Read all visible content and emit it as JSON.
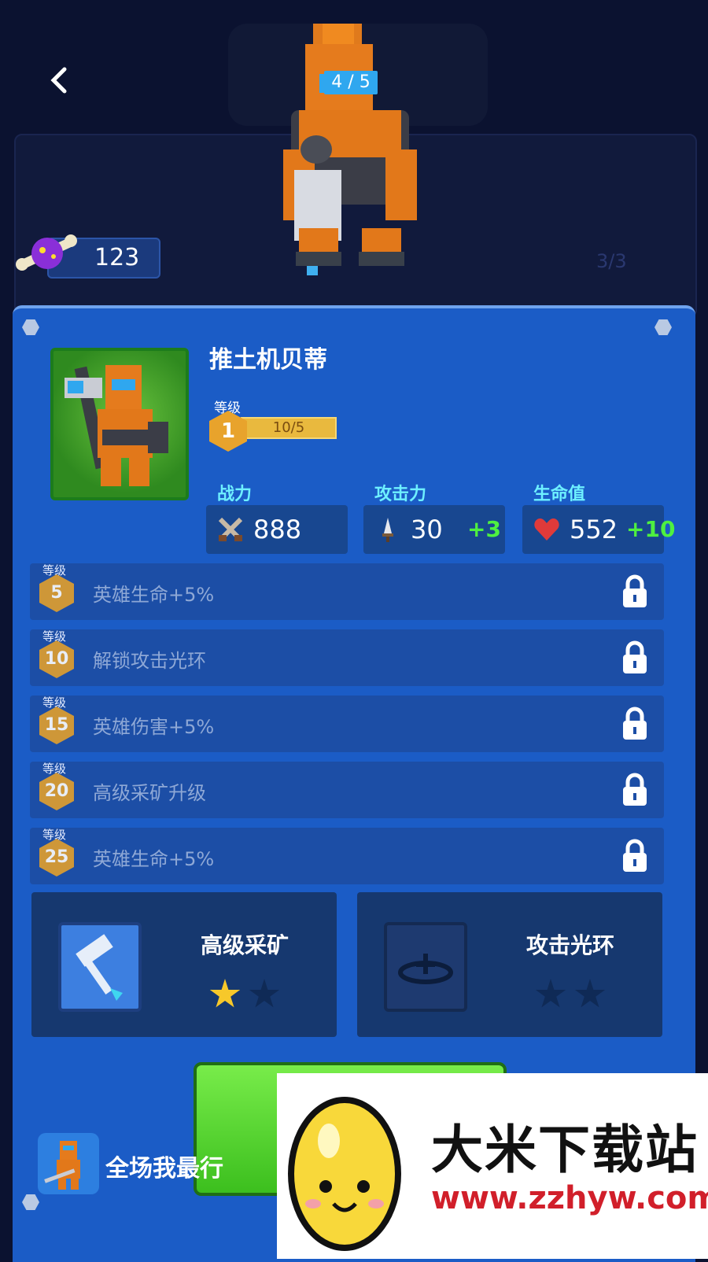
{
  "header": {
    "back_icon": "chevron-left-icon",
    "hero_index": "4 / 5",
    "faded_count": "3/3"
  },
  "currency": {
    "icon": "candy-icon",
    "amount": "123"
  },
  "hero": {
    "name": "推土机贝蒂",
    "level_label": "等级",
    "level": "1",
    "xp": "10/5"
  },
  "stats": [
    {
      "label": "战力",
      "icon": "swords-icon",
      "value": "888",
      "bonus": ""
    },
    {
      "label": "攻击力",
      "icon": "dagger-icon",
      "value": "30",
      "bonus": "+3"
    },
    {
      "label": "生命值",
      "icon": "heart-icon",
      "value": "552",
      "bonus": "+10"
    }
  ],
  "perks": [
    {
      "tag": "等级",
      "level": "5",
      "text": "英雄生命+5%",
      "locked": true
    },
    {
      "tag": "等级",
      "level": "10",
      "text": "解锁攻击光环",
      "locked": true
    },
    {
      "tag": "等级",
      "level": "15",
      "text": "英雄伤害+5%",
      "locked": true
    },
    {
      "tag": "等级",
      "level": "20",
      "text": "高级采矿升级",
      "locked": true
    },
    {
      "tag": "等级",
      "level": "25",
      "text": "英雄生命+5%",
      "locked": true
    }
  ],
  "skills": [
    {
      "name": "高级采矿",
      "icon": "hammer-icon",
      "stars": 1,
      "max_stars": 2
    },
    {
      "name": "攻击光环",
      "icon": "aura-icon",
      "stars": 0,
      "max_stars": 2
    }
  ],
  "footer": {
    "mini_text": "全场我最行"
  },
  "watermark": {
    "title": "大米下载站",
    "url": "www.zzhyw.com"
  },
  "colors": {
    "panel": "#1b5cc6",
    "accent_stat": "#6ef0ff",
    "bonus": "#4ef040",
    "hex_gold": "#e8a32c"
  }
}
